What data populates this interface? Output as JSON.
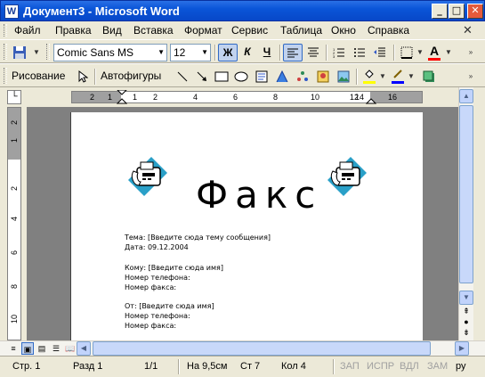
{
  "window": {
    "title": "Документ3 - Microsoft Word",
    "app_icon": "W",
    "minimize": "_",
    "maximize": "□",
    "close": "✕"
  },
  "menu": {
    "items": [
      "Файл",
      "Правка",
      "Вид",
      "Вставка",
      "Формат",
      "Сервис",
      "Таблица",
      "Окно",
      "Справка"
    ],
    "close_doc": "✕"
  },
  "formatting_toolbar": {
    "font_name": "Comic Sans MS",
    "font_size": "12",
    "bold": "Ж",
    "italic": "К",
    "underline": "Ч"
  },
  "drawing_toolbar": {
    "drawing_label": "Рисование",
    "autoshapes_label": "Автофигуры"
  },
  "ruler": {
    "top_numbers": [
      "2",
      "1",
      "1",
      "2",
      "4",
      "6",
      "8",
      "10",
      "12",
      "14",
      "16"
    ],
    "left_numbers": [
      "2",
      "1",
      "2",
      "4",
      "6",
      "8",
      "10"
    ]
  },
  "document": {
    "heading": "Факс",
    "lines": [
      "Тема: [Введите сюда тему сообщения]",
      "Дата: 09.12.2004",
      "Кому: [Введите сюда имя]",
      "Номер телефона:",
      "Номер факса:",
      "От: [Введите сюда имя]",
      "Номер телефона:",
      "Номер факса:"
    ]
  },
  "status": {
    "page": "Стр. 1",
    "section": "Разд 1",
    "pages": "1/1",
    "at": "На 9,5см",
    "line": "Ст 7",
    "col": "Кол 4",
    "rec": "ЗАП",
    "trk": "ИСПР",
    "ext": "ВДЛ",
    "ovr": "ЗАМ",
    "lang": "ру"
  },
  "colors": {
    "titlebar": "#0a55d8",
    "chrome": "#ece9d8",
    "font_color_red": "#ff0000",
    "highlight_yellow": "#ffff00",
    "line_color_blue": "#0000ff",
    "fax_icon_teal": "#2aa0c8"
  }
}
